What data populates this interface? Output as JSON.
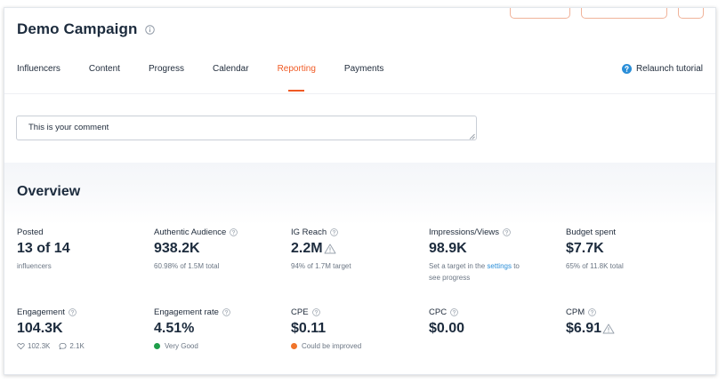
{
  "header": {
    "title": "Demo Campaign"
  },
  "tabs": [
    {
      "label": "Influencers",
      "active": false
    },
    {
      "label": "Content",
      "active": false
    },
    {
      "label": "Progress",
      "active": false
    },
    {
      "label": "Calendar",
      "active": false
    },
    {
      "label": "Reporting",
      "active": true
    },
    {
      "label": "Payments",
      "active": false
    }
  ],
  "relaunch_label": "Relaunch tutorial",
  "comment": {
    "value": "This is your comment"
  },
  "overview": {
    "title": "Overview",
    "metrics": [
      {
        "label": "Posted",
        "value": "13 of 14",
        "sub": "influencers"
      },
      {
        "label": "Authentic Audience",
        "value": "938.2K",
        "sub": "60.98% of 1.5M total"
      },
      {
        "label": "IG Reach",
        "value": "2.2M",
        "sub": "94% of 1.7M target"
      },
      {
        "label": "Impressions/Views",
        "value": "98.9K",
        "sub_prefix": "Set a target in the",
        "sub_link": "settings",
        "sub_suffix": "to",
        "sub_line2": "see progress"
      },
      {
        "label": "Budget spent",
        "value": "$7.7K",
        "sub": "65% of 11.8K total"
      },
      {
        "label": "Engagement",
        "value": "104.3K",
        "likes": "102.3K",
        "comments": "2.1K"
      },
      {
        "label": "Engagement rate",
        "value": "4.51%",
        "status": "Very Good",
        "status_color": "#1f9e4a"
      },
      {
        "label": "CPE",
        "value": "$0.11",
        "status": "Could be improved",
        "status_color": "#f0742a"
      },
      {
        "label": "CPC",
        "value": "$0.00"
      },
      {
        "label": "CPM",
        "value": "$6.91"
      }
    ]
  },
  "colors": {
    "accent": "#f05a24",
    "link": "#2a8ed8",
    "help": "#2a8ed8"
  }
}
